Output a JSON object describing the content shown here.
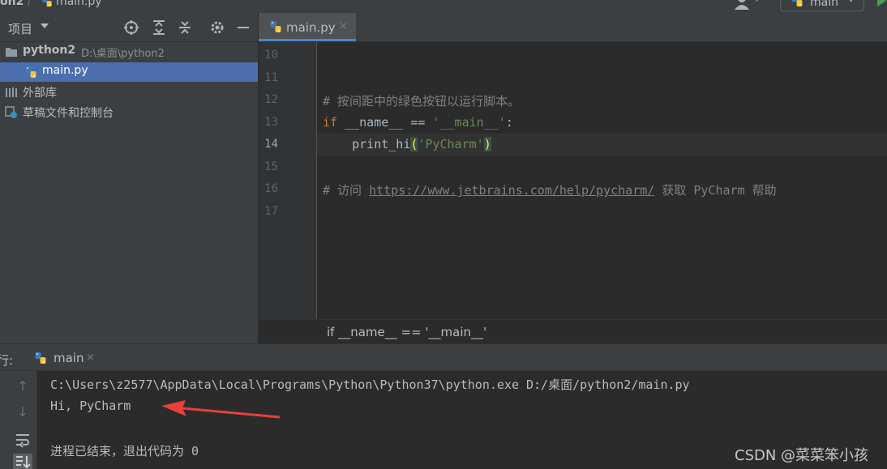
{
  "topbar": {
    "project_fragment": "on2",
    "file_fragment": "main.py",
    "run_config": "main"
  },
  "project_panel": {
    "title": "项目",
    "tree": [
      {
        "label": "python2",
        "path": "D:\\桌面\\python2"
      },
      {
        "label": "main.py"
      },
      {
        "label": "外部库"
      },
      {
        "label": "草稿文件和控制台"
      }
    ]
  },
  "editor": {
    "tab": {
      "label": "main.py",
      "close": "×"
    },
    "lines": [
      {
        "num": "10"
      },
      {
        "num": "11"
      },
      {
        "num": "12",
        "comment": "# 按间距中的绿色按钮以运行脚本。"
      },
      {
        "num": "13",
        "kw": "if",
        "name": " __name__ == ",
        "str": "'__main__'",
        "tail": ":"
      },
      {
        "num": "14",
        "indent": "    ",
        "fn": "print_hi",
        "open": "(",
        "str": "'PyCharm'",
        "close": ")"
      },
      {
        "num": "15"
      },
      {
        "num": "16",
        "comment_pre": "# 访问 ",
        "url": "https://www.jetbrains.com/help/pycharm/",
        "comment_post": " 获取 PyCharm 帮助"
      },
      {
        "num": "17"
      }
    ],
    "breadcrumb": "if __name__ == '__main__'"
  },
  "run_panel": {
    "label": "行:",
    "tab": {
      "label": "main",
      "close": "×"
    },
    "output": [
      "C:\\Users\\z2577\\AppData\\Local\\Programs\\Python\\Python37\\python.exe D:/桌面/python2/main.py",
      "Hi, PyCharm",
      "进程已结束，退出代码为 0"
    ]
  },
  "watermark": "CSDN @菜菜笨小孩",
  "colors": {
    "keyword": "#cc7832",
    "string": "#6a8759",
    "comment": "#808080",
    "selection": "#4b6eaf",
    "annotation_arrow": "#e8403a"
  }
}
